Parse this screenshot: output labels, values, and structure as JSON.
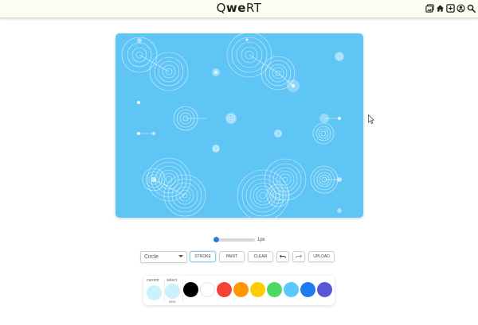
{
  "app": {
    "logo_left": "Q",
    "logo_bold": "we",
    "logo_right": "RT"
  },
  "toolbar": {
    "icons": [
      "gallery-icon",
      "home-icon",
      "add-icon",
      "user-icon",
      "search-icon"
    ]
  },
  "canvas": {
    "background": "#5ec5f5",
    "stroke_color": "#ffffff"
  },
  "size": {
    "value": 1,
    "label": "1px"
  },
  "controls": {
    "shape_select": "Circle",
    "stroke_label": "STROKE",
    "paint_label": "PAINT",
    "clear_label": "CLEAR",
    "upload_label": "UPLOAD",
    "active_mode": "stroke"
  },
  "palette": {
    "current_label": "current",
    "select_label": "select",
    "add_label": "ADD",
    "current_color": "#c9f2fa",
    "select_color": "#c9f2fa",
    "colors": [
      "#000000",
      "#ffffff",
      "#f44336",
      "#ff9800",
      "#ffcc00",
      "#4cd964",
      "#5ac8fa",
      "#1e7bf0",
      "#5856d6"
    ]
  }
}
